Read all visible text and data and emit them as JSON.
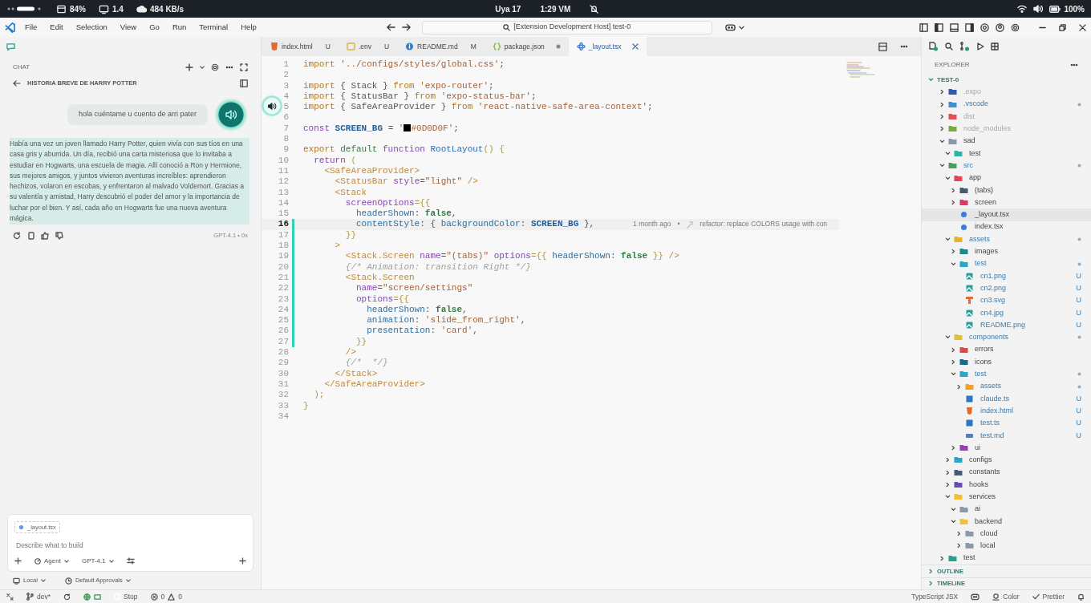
{
  "system_bar": {
    "stats": [
      {
        "kind": "cpu",
        "value": "84%"
      },
      {
        "kind": "display",
        "value": "1.4"
      },
      {
        "kind": "network",
        "value": "484 KB/s"
      }
    ],
    "date": "Uya 17",
    "time": "1:29 VM",
    "battery": "100%"
  },
  "menu": [
    "File",
    "Edit",
    "Selection",
    "View",
    "Go",
    "Run",
    "Terminal",
    "Help"
  ],
  "command_center": "[Extension Development Host] test-0",
  "chat": {
    "header": "CHAT",
    "title": "HISTORIA BREVE DE HARRY POTTER",
    "user_message": "hola cuéntame u cuento de arri pater",
    "response": {
      "text": "Había una vez un joven llamado Harry Potter, quien vivía con sus tíos en una casa gris y aburrida. Un día, recibió una carta misteriosa que lo invitaba a estudiar en Hogwarts, una escuela de magia. Allí conoció a Ron y Hermione, sus mejores amigos, y juntos vivieron aventuras increíbles: aprendieron hechizos, volaron en escobas, y enfrentaron al malvado Voldemort. Gracias a su valentía y amistad, Harry descubrió el poder del amor y la importancia de luchar por el bien. Y así, cada año en Hogwarts fue una nueva aventura mágica.",
      "reading": true,
      "model": "GPT-4.1 • 0x"
    },
    "input": {
      "context_file": "_layout.tsx",
      "placeholder": "Describe what to build",
      "mode": "Agent",
      "model": "GPT-4.1"
    },
    "options": [
      "Local",
      "Default Approvals"
    ]
  },
  "tabs": [
    {
      "label": "index.html",
      "badge": "U",
      "kind": "html",
      "selected": false,
      "dirty": false
    },
    {
      "label": ".env",
      "badge": "U",
      "kind": "env",
      "selected": false,
      "dirty": false
    },
    {
      "label": "README.md",
      "badge": "M",
      "kind": "markdown",
      "selected": false,
      "dirty": false
    },
    {
      "label": "package.json",
      "kind": "json",
      "selected": false,
      "dirty": true
    },
    {
      "label": "_layout.tsx",
      "kind": "tsx",
      "selected": true,
      "dirty": false
    }
  ],
  "editor": {
    "lines": [
      {
        "number": "1",
        "current": false,
        "modified": false,
        "tokens": [
          {
            "text": "import",
            "kind": "keyword"
          },
          {
            "text": " '../configs/styles/global.css'",
            "kind": "string"
          },
          {
            "text": ";",
            "kind": "plain"
          }
        ]
      },
      {
        "number": "2",
        "current": false,
        "modified": false
      },
      {
        "number": "3",
        "current": false,
        "modified": false,
        "tokens": [
          {
            "text": "import",
            "kind": "keyword"
          },
          {
            "text": " { Stack } ",
            "kind": "plain"
          },
          {
            "text": "from",
            "kind": "keyword"
          },
          {
            "text": " 'expo-router'",
            "kind": "string"
          },
          {
            "text": ";",
            "kind": "plain"
          }
        ]
      },
      {
        "number": "4",
        "current": false,
        "modified": false,
        "tokens": [
          {
            "text": "import",
            "kind": "keyword"
          },
          {
            "text": " { StatusBar } ",
            "kind": "plain"
          },
          {
            "text": "from",
            "kind": "keyword"
          },
          {
            "text": " 'expo-status-bar'",
            "kind": "string"
          },
          {
            "text": ";",
            "kind": "plain"
          }
        ]
      },
      {
        "number": "5",
        "current": false,
        "modified": false,
        "tokens": [
          {
            "text": "import",
            "kind": "keyword"
          },
          {
            "text": " { SafeAreaProvider } ",
            "kind": "plain"
          },
          {
            "text": "from",
            "kind": "keyword"
          },
          {
            "text": " 'react-native-safe-area-context'",
            "kind": "string"
          },
          {
            "text": ";",
            "kind": "plain"
          }
        ]
      },
      {
        "number": "6",
        "current": false,
        "modified": false
      },
      {
        "number": "7",
        "current": false,
        "modified": false,
        "tokens": [
          {
            "text": "const",
            "kind": "storage"
          },
          {
            "text": " SCREEN_BG",
            "kind": "constant"
          },
          {
            "text": " = ",
            "kind": "plain"
          },
          {
            "text": "'",
            "kind": "string"
          },
          {
            "kind": "swatch"
          },
          {
            "text": "#0D0D0F'",
            "kind": "string"
          },
          {
            "text": ";",
            "kind": "plain"
          }
        ]
      },
      {
        "number": "8",
        "current": false,
        "modified": false
      },
      {
        "number": "9",
        "current": false,
        "modified": false,
        "tokens": [
          {
            "text": "export",
            "kind": "keyword"
          },
          {
            "text": " default",
            "kind": "modifier"
          },
          {
            "text": " function",
            "kind": "storage"
          },
          {
            "text": " RootLayout",
            "kind": "function"
          },
          {
            "text": "() {",
            "kind": "brace"
          }
        ]
      },
      {
        "number": "10",
        "current": false,
        "modified": false,
        "tokens": [
          {
            "text": "  return",
            "kind": "storage"
          },
          {
            "text": " (",
            "kind": "brace"
          }
        ]
      },
      {
        "number": "11",
        "current": false,
        "modified": false,
        "tokens": [
          {
            "text": "    <SafeAreaProvider>",
            "kind": "tag"
          }
        ]
      },
      {
        "number": "12",
        "current": false,
        "modified": false,
        "tokens": [
          {
            "text": "      <StatusBar",
            "kind": "tag"
          },
          {
            "text": " style",
            "kind": "attribute"
          },
          {
            "text": "=",
            "kind": "plain"
          },
          {
            "text": "\"light\"",
            "kind": "string"
          },
          {
            "text": " />",
            "kind": "tag"
          }
        ]
      },
      {
        "number": "13",
        "current": false,
        "modified": false,
        "tokens": [
          {
            "text": "      <Stack",
            "kind": "tag"
          }
        ]
      },
      {
        "number": "14",
        "current": false,
        "modified": false,
        "tokens": [
          {
            "text": "        screenOptions",
            "kind": "attribute"
          },
          {
            "text": "={{",
            "kind": "brace"
          }
        ]
      },
      {
        "number": "15",
        "current": false,
        "modified": false,
        "tokens": [
          {
            "text": "          headerShown",
            "kind": "property"
          },
          {
            "text": ": ",
            "kind": "plain"
          },
          {
            "text": "false",
            "kind": "boolean"
          },
          {
            "text": ",",
            "kind": "plain"
          }
        ]
      },
      {
        "number": "16",
        "current": true,
        "modified": true,
        "tokens": [
          {
            "text": "          contentStyle",
            "kind": "property"
          },
          {
            "text": ": { ",
            "kind": "plain"
          },
          {
            "text": "backgroundColor",
            "kind": "property"
          },
          {
            "text": ": ",
            "kind": "plain"
          },
          {
            "text": "SCREEN_BG",
            "kind": "constant"
          },
          {
            "text": " },",
            "kind": "plain"
          }
        ],
        "blame": {
          "age": "1 month ago",
          "separator": "•",
          "message": "refactor: replace COLORS usage with con"
        }
      },
      {
        "number": "17",
        "current": false,
        "modified": true,
        "tokens": [
          {
            "text": "        }}",
            "kind": "brace"
          }
        ]
      },
      {
        "number": "18",
        "current": false,
        "modified": true,
        "tokens": [
          {
            "text": "      >",
            "kind": "tag"
          }
        ]
      },
      {
        "number": "19",
        "current": false,
        "modified": true,
        "tokens": [
          {
            "text": "        <Stack.Screen",
            "kind": "tag"
          },
          {
            "text": " name",
            "kind": "attribute"
          },
          {
            "text": "=",
            "kind": "plain"
          },
          {
            "text": "\"(tabs)\"",
            "kind": "string"
          },
          {
            "text": " options",
            "kind": "attribute"
          },
          {
            "text": "={{ ",
            "kind": "brace"
          },
          {
            "text": "headerShown",
            "kind": "property"
          },
          {
            "text": ": ",
            "kind": "plain"
          },
          {
            "text": "false",
            "kind": "boolean"
          },
          {
            "text": " }}",
            "kind": "brace"
          },
          {
            "text": " />",
            "kind": "tag"
          }
        ]
      },
      {
        "number": "20",
        "current": false,
        "modified": true,
        "tokens": [
          {
            "text": "        {/* Animation: transition Right */}",
            "kind": "comment"
          }
        ]
      },
      {
        "number": "21",
        "current": false,
        "modified": true,
        "tokens": [
          {
            "text": "        <Stack.Screen",
            "kind": "tag"
          }
        ]
      },
      {
        "number": "22",
        "current": false,
        "modified": true,
        "tokens": [
          {
            "text": "          name",
            "kind": "attribute"
          },
          {
            "text": "=",
            "kind": "plain"
          },
          {
            "text": "\"screen/settings\"",
            "kind": "string"
          }
        ]
      },
      {
        "number": "23",
        "current": false,
        "modified": true,
        "tokens": [
          {
            "text": "          options",
            "kind": "attribute"
          },
          {
            "text": "={{",
            "kind": "brace"
          }
        ]
      },
      {
        "number": "24",
        "current": false,
        "modified": true,
        "tokens": [
          {
            "text": "            headerShown",
            "kind": "property"
          },
          {
            "text": ": ",
            "kind": "plain"
          },
          {
            "text": "false",
            "kind": "boolean"
          },
          {
            "text": ",",
            "kind": "plain"
          }
        ]
      },
      {
        "number": "25",
        "current": false,
        "modified": true,
        "tokens": [
          {
            "text": "            animation",
            "kind": "property"
          },
          {
            "text": ": ",
            "kind": "plain"
          },
          {
            "text": "'slide_from_right'",
            "kind": "string"
          },
          {
            "text": ",",
            "kind": "plain"
          }
        ]
      },
      {
        "number": "26",
        "current": false,
        "modified": true,
        "tokens": [
          {
            "text": "            presentation",
            "kind": "property"
          },
          {
            "text": ": ",
            "kind": "plain"
          },
          {
            "text": "'card'",
            "kind": "string"
          },
          {
            "text": ",",
            "kind": "plain"
          }
        ]
      },
      {
        "number": "27",
        "current": false,
        "modified": true,
        "tokens": [
          {
            "text": "          }}",
            "kind": "brace"
          }
        ]
      },
      {
        "number": "28",
        "current": false,
        "modified": false,
        "tokens": [
          {
            "text": "        />",
            "kind": "tag"
          }
        ]
      },
      {
        "number": "29",
        "current": false,
        "modified": false,
        "tokens": [
          {
            "text": "        {/*  */}",
            "kind": "comment"
          }
        ]
      },
      {
        "number": "30",
        "current": false,
        "modified": false,
        "tokens": [
          {
            "text": "      </Stack>",
            "kind": "tag"
          }
        ]
      },
      {
        "number": "31",
        "current": false,
        "modified": false,
        "tokens": [
          {
            "text": "    </SafeAreaProvider>",
            "kind": "tag"
          }
        ]
      },
      {
        "number": "32",
        "current": false,
        "modified": false,
        "tokens": [
          {
            "text": "  );",
            "kind": "brace"
          }
        ]
      },
      {
        "number": "33",
        "current": false,
        "modified": false,
        "tokens": [
          {
            "text": "}",
            "kind": "brace"
          }
        ]
      },
      {
        "number": "34",
        "current": false,
        "modified": false
      }
    ]
  },
  "explorer": {
    "title": "EXPLORER",
    "root": {
      "name": "TEST-0",
      "expanded": true
    },
    "tree": [
      {
        "name": ".expo",
        "kind": "folder",
        "color": "#2b5fad",
        "expanded": false,
        "selected": false,
        "changed": false,
        "ignored": true
      },
      {
        "name": ".vscode",
        "kind": "folder",
        "color": "#3d8fd6",
        "expanded": false,
        "selected": false,
        "changed": true,
        "ignored": false
      },
      {
        "name": "dist",
        "kind": "folder",
        "color": "#e05252",
        "expanded": false,
        "selected": false,
        "changed": false,
        "ignored": true
      },
      {
        "name": "node_modules",
        "kind": "folder",
        "color": "#7cab3c",
        "expanded": false,
        "selected": false,
        "changed": false,
        "ignored": true
      },
      {
        "name": "sad",
        "kind": "folder",
        "color": "#8a98a8",
        "expanded": true,
        "selected": false,
        "changed": false,
        "ignored": false,
        "children": [
          {
            "name": "test",
            "kind": "folder",
            "color": "#2bb5a5",
            "expanded": true,
            "selected": false,
            "changed": false,
            "ignored": false
          }
        ]
      },
      {
        "name": "src",
        "kind": "folder",
        "color": "#4aa05a",
        "expanded": true,
        "selected": false,
        "changed": true,
        "ignored": false,
        "children": [
          {
            "name": "app",
            "kind": "folder",
            "color": "#e0455a",
            "expanded": true,
            "selected": false,
            "changed": false,
            "ignored": false,
            "children": [
              {
                "name": "(tabs)",
                "kind": "folder",
                "color": "#4a5a6a",
                "expanded": false,
                "selected": false,
                "changed": false,
                "ignored": false
              },
              {
                "name": "screen",
                "kind": "folder",
                "color": "#d83a6a",
                "expanded": false,
                "selected": false,
                "changed": false,
                "ignored": false
              },
              {
                "name": "_layout.tsx",
                "kind": "react",
                "color": "#3d7fd6",
                "selected": true,
                "changed": false,
                "ignored": false
              },
              {
                "name": "index.tsx",
                "kind": "react",
                "color": "#3d7fd6",
                "selected": false,
                "changed": false,
                "ignored": false
              }
            ]
          },
          {
            "name": "assets",
            "kind": "folder",
            "color": "#e6b030",
            "expanded": true,
            "selected": false,
            "changed": true,
            "ignored": false,
            "children": [
              {
                "name": "images",
                "kind": "folder",
                "color": "#1f8a8a",
                "expanded": false,
                "selected": false,
                "changed": false,
                "ignored": false
              },
              {
                "name": "test",
                "kind": "folder",
                "color": "#29a6c8",
                "expanded": true,
                "selected": false,
                "changed": true,
                "ignored": false,
                "children": [
                  {
                    "name": "cn1.png",
                    "kind": "image",
                    "color": "#2aa198",
                    "badge": "U",
                    "selected": false,
                    "changed": false,
                    "ignored": false
                  },
                  {
                    "name": "cn2.png",
                    "kind": "image",
                    "color": "#2aa198",
                    "badge": "U",
                    "selected": false,
                    "changed": false,
                    "ignored": false
                  },
                  {
                    "name": "cn3.svg",
                    "kind": "svg",
                    "color": "#e06c3c",
                    "badge": "U",
                    "selected": false,
                    "changed": false,
                    "ignored": false
                  },
                  {
                    "name": "cn4.jpg",
                    "kind": "image",
                    "color": "#2aa198",
                    "badge": "U",
                    "selected": false,
                    "changed": false,
                    "ignored": false
                  },
                  {
                    "name": "README.png",
                    "kind": "image",
                    "color": "#2aa198",
                    "badge": "U",
                    "selected": false,
                    "changed": false,
                    "ignored": false
                  }
                ]
              }
            ]
          },
          {
            "name": "components",
            "kind": "folder",
            "color": "#d9c23a",
            "expanded": true,
            "selected": false,
            "changed": true,
            "ignored": false,
            "children": [
              {
                "name": "errors",
                "kind": "folder",
                "color": "#e04848",
                "expanded": false,
                "selected": false,
                "changed": false,
                "ignored": false
              },
              {
                "name": "icons",
                "kind": "folder",
                "color": "#1e6a8a",
                "expanded": false,
                "selected": false,
                "changed": false,
                "ignored": false
              },
              {
                "name": "test",
                "kind": "folder",
                "color": "#29a6c8",
                "expanded": true,
                "selected": false,
                "changed": true,
                "ignored": false,
                "children": [
                  {
                    "name": "assets",
                    "kind": "folder",
                    "color": "#f0a030",
                    "expanded": false,
                    "selected": false,
                    "changed": true,
                    "ignored": false
                  },
                  {
                    "name": "claude.ts",
                    "kind": "ts",
                    "color": "#2f74c0",
                    "badge": "U",
                    "selected": false,
                    "changed": false,
                    "ignored": false
                  },
                  {
                    "name": "index.html",
                    "kind": "html",
                    "color": "#e4692a",
                    "badge": "U",
                    "selected": false,
                    "changed": false,
                    "ignored": false
                  },
                  {
                    "name": "test.ts",
                    "kind": "ts",
                    "color": "#2f74c0",
                    "badge": "U",
                    "selected": false,
                    "changed": false,
                    "ignored": false
                  },
                  {
                    "name": "test.md",
                    "kind": "md",
                    "color": "#4d80c8",
                    "badge": "U",
                    "selected": false,
                    "changed": false,
                    "ignored": false
                  }
                ]
              },
              {
                "name": "ui",
                "kind": "folder",
                "color": "#9c3ab8",
                "expanded": false,
                "selected": false,
                "changed": false,
                "ignored": false
              }
            ]
          },
          {
            "name": "configs",
            "kind": "folder",
            "color": "#2aa4c8",
            "expanded": false,
            "selected": false,
            "changed": false,
            "ignored": false
          },
          {
            "name": "constants",
            "kind": "folder",
            "color": "#4a5a70",
            "expanded": false,
            "selected": false,
            "changed": false,
            "ignored": false
          },
          {
            "name": "hooks",
            "kind": "folder",
            "color": "#6a4ab8",
            "expanded": false,
            "selected": false,
            "changed": false,
            "ignored": false
          },
          {
            "name": "services",
            "kind": "folder",
            "color": "#f0c030",
            "expanded": true,
            "selected": false,
            "changed": false,
            "ignored": false,
            "children": [
              {
                "name": "ai",
                "kind": "folder",
                "color": "#8a98a8",
                "expanded": true,
                "selected": false,
                "changed": false,
                "ignored": false
              },
              {
                "name": "backend",
                "kind": "folder",
                "color": "#f0c040",
                "expanded": true,
                "selected": false,
                "changed": false,
                "ignored": false,
                "children": [
                  {
                    "name": "cloud",
                    "kind": "folder",
                    "color": "#8a98a8",
                    "expanded": false,
                    "selected": false,
                    "changed": false,
                    "ignored": false
                  },
                  {
                    "name": "local",
                    "kind": "folder",
                    "color": "#8a98a8",
                    "expanded": false,
                    "selected": false,
                    "changed": false,
                    "ignored": false
                  }
                ]
              }
            ]
          }
        ]
      },
      {
        "name": "test",
        "kind": "folder",
        "color": "#2aa18a",
        "expanded": false,
        "selected": false,
        "changed": false,
        "ignored": false
      }
    ],
    "sections": [
      {
        "label": "OUTLINE",
        "expanded": false
      },
      {
        "label": "TIMELINE",
        "expanded": false
      }
    ]
  },
  "status_bar": {
    "branch": "dev*",
    "stop": "Stop",
    "errors": "0",
    "warnings": "0",
    "language": "TypeScript JSX",
    "color_picker": "Color",
    "formatter": "Prettier"
  }
}
